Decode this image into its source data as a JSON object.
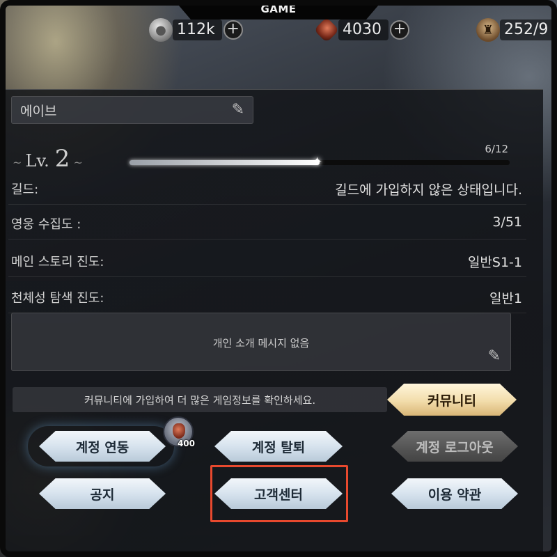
{
  "screen_label": "GAME",
  "currencies": {
    "silver": {
      "icon": "silver-coin-icon",
      "value": "112k"
    },
    "gem": {
      "icon": "red-gem-icon",
      "value": "4030"
    },
    "stamina": {
      "icon": "stamina-icon",
      "value": "252/9"
    }
  },
  "profile": {
    "name": "에이브",
    "level_prefix": "Lv.",
    "level": "2",
    "exp_text": "6/12",
    "exp_fraction": 0.5
  },
  "stats": [
    {
      "label": "길드:",
      "value": "길드에 가입하지 않은 상태입니다."
    },
    {
      "label": "영웅 수집도 :",
      "value": "3/51"
    },
    {
      "label": "메인 스토리 진도:",
      "value": "일반S1-1"
    },
    {
      "label": "천체성 탐색 진도:",
      "value": "일반1"
    }
  ],
  "intro_message": "개인 소개 메시지 없음",
  "community": {
    "prompt": "커뮤니티에 가입하여 더 많은 게임정보를 확인하세요.",
    "button": "커뮤니티"
  },
  "buttons": {
    "account_link": "계정 연동",
    "account_delete": "계정 탈퇴",
    "logout": "계정 로그아웃",
    "notice": "공지",
    "support": "고객센터",
    "terms": "이용 약관"
  },
  "reward_badge": {
    "icon": "red-gem-icon",
    "count": "400"
  },
  "colors": {
    "highlight": "#e8492e",
    "community_glow": "#f0be64",
    "button_face": "#d7e3ee"
  }
}
